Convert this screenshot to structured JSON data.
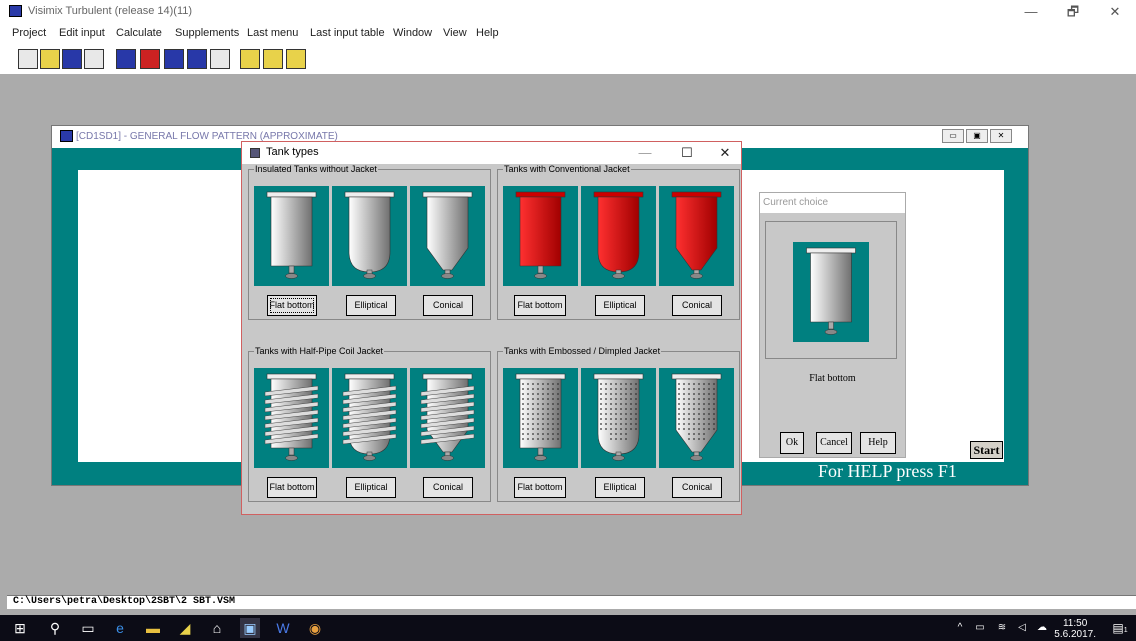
{
  "window": {
    "title": "Visimix Turbulent (release 14)(11)",
    "minimize": "—",
    "maximize": "🗗",
    "close": "✕"
  },
  "menu": [
    "Project",
    "Edit input",
    "Calculate",
    "Supplements",
    "Last menu",
    "Last input table",
    "Window",
    "View",
    "Help"
  ],
  "toolbar_icons": [
    "new-file-icon",
    "open-folder-icon",
    "save-icon",
    "print-icon",
    "tank-icon",
    "shield-icon",
    "pipe-icon",
    "probe-icon",
    "table-icon",
    "split-view-icon",
    "forward-icon",
    "export-icon"
  ],
  "mdi": {
    "title": "[CD1SD1] - GENERAL FLOW PATTERN (APPROXIMATE)",
    "help_text": "For HELP press F1",
    "start_label": "Start"
  },
  "dialog": {
    "title": "Tank types",
    "groups": [
      {
        "label": "Insulated Tanks without Jacket",
        "style": "insulated",
        "buttons": [
          "Flat bottom",
          "Elliptical",
          "Conical"
        ]
      },
      {
        "label": "Tanks with Conventional Jacket",
        "style": "red",
        "buttons": [
          "Flat bottom",
          "Elliptical",
          "Conical"
        ]
      },
      {
        "label": "Tanks with Half-Pipe  Coil Jacket",
        "style": "coil",
        "buttons": [
          "Flat bottom",
          "Elliptical",
          "Conical"
        ]
      },
      {
        "label": "Tanks with Embossed / Dimpled  Jacket",
        "style": "dimpled",
        "buttons": [
          "Flat bottom",
          "Elliptical",
          "Conical"
        ]
      }
    ],
    "selected": "Flat bottom"
  },
  "choice": {
    "header": "Current choice",
    "label": "Flat bottom",
    "ok": "Ok",
    "cancel": "Cancel",
    "help": "Help"
  },
  "status": {
    "path": "C:\\Users\\petra\\Desktop\\2SBT\\2 SBT.VSM"
  },
  "taskbar": {
    "time": "11:50",
    "date": "5.6.2017.",
    "notifications": "1"
  }
}
